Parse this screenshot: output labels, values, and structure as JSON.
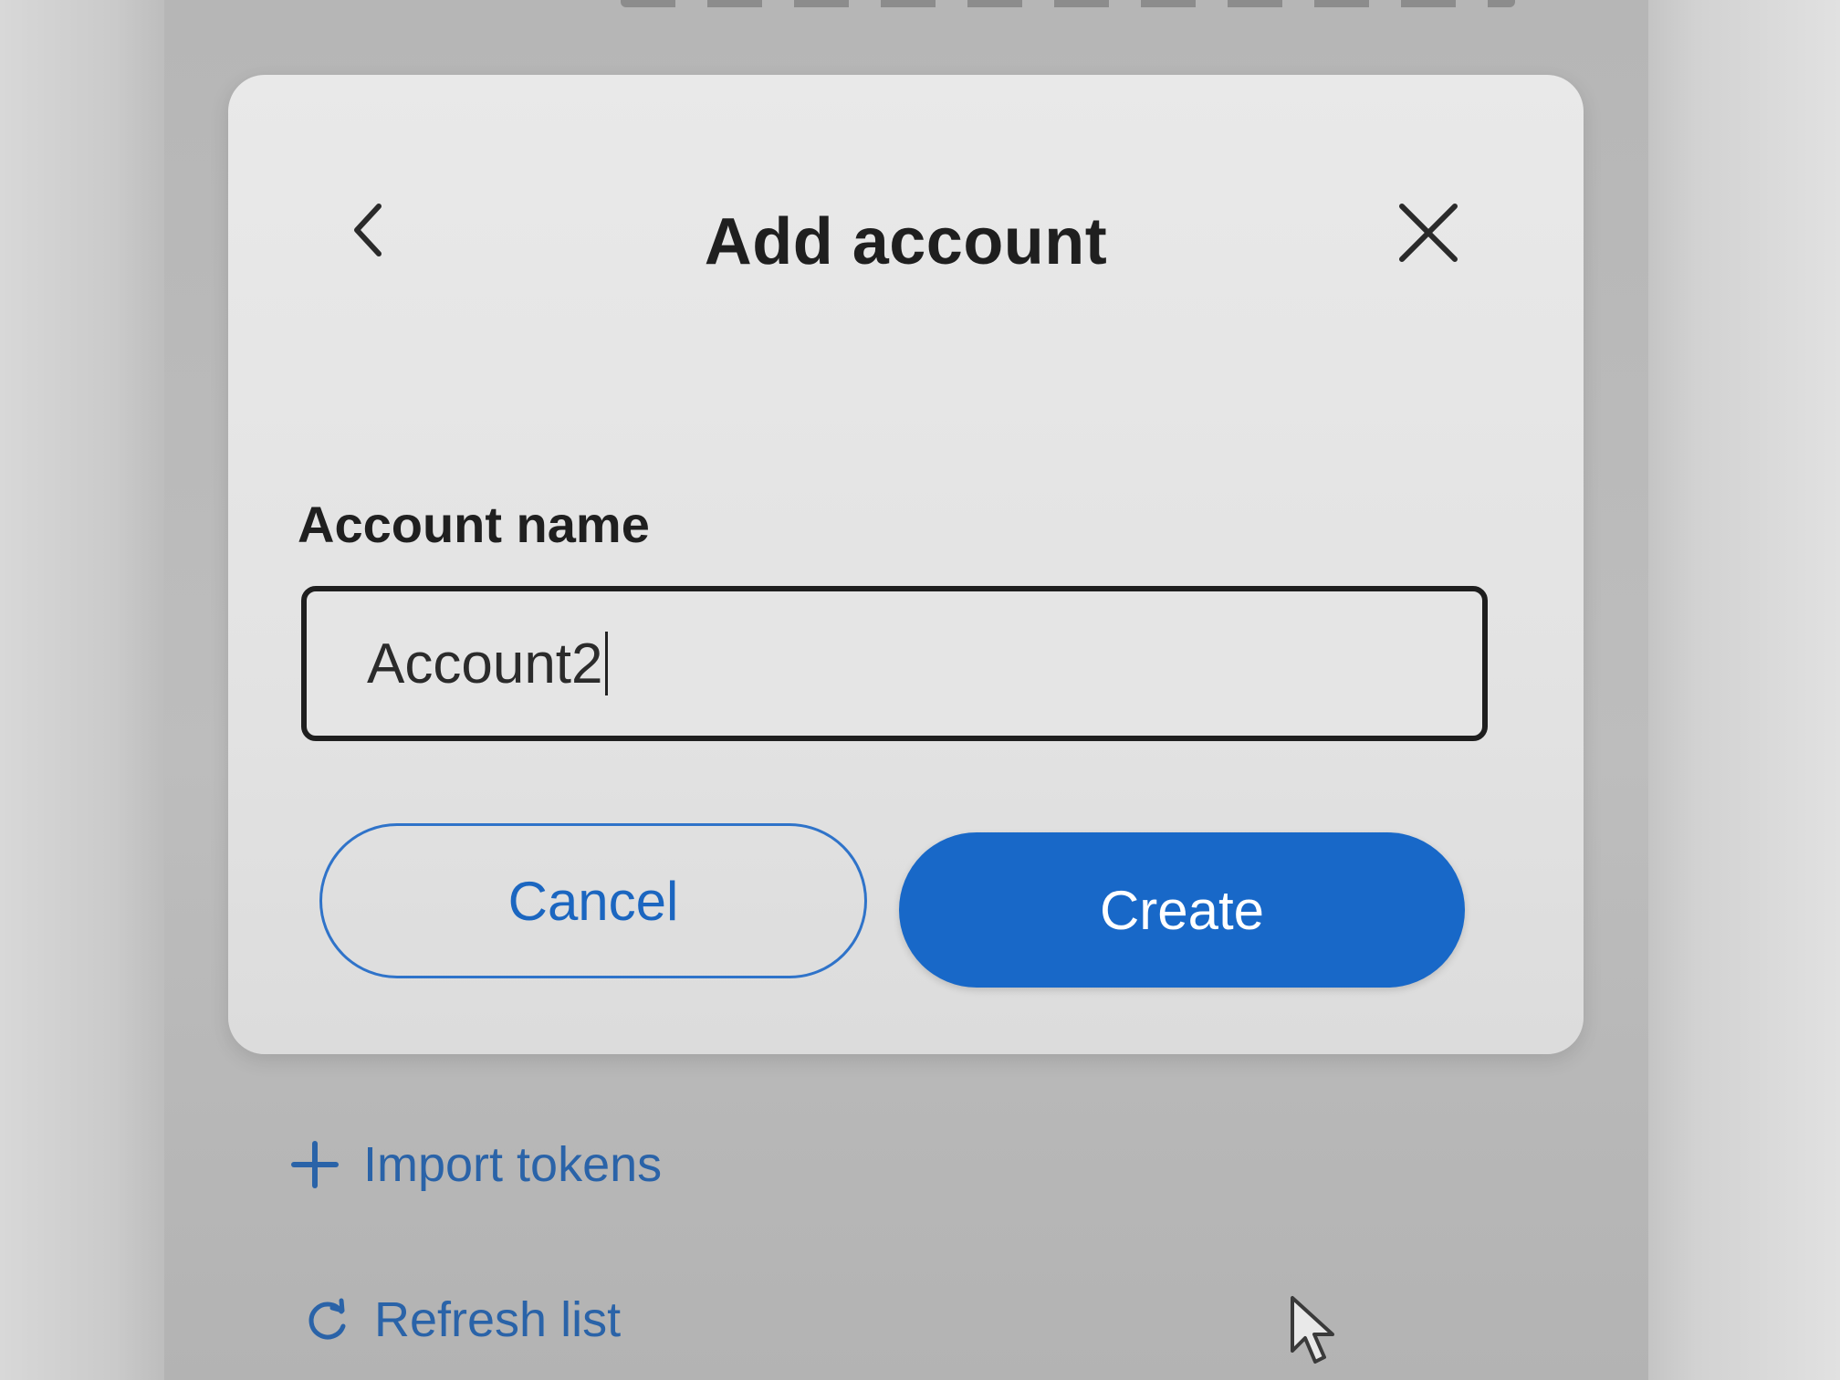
{
  "modal": {
    "title": "Add account",
    "back_icon": "chevron-left-icon",
    "close_icon": "close-icon",
    "field_label": "Account name",
    "input_value": "Account2",
    "cancel_label": "Cancel",
    "create_label": "Create"
  },
  "actions": {
    "import_label": "Import tokens",
    "import_icon": "plus-icon",
    "refresh_label": "Refresh list",
    "refresh_icon": "refresh-icon"
  },
  "colors": {
    "accent": "#1868c8",
    "accent_text": "#1b66c0",
    "link_text": "#2a63a8"
  }
}
